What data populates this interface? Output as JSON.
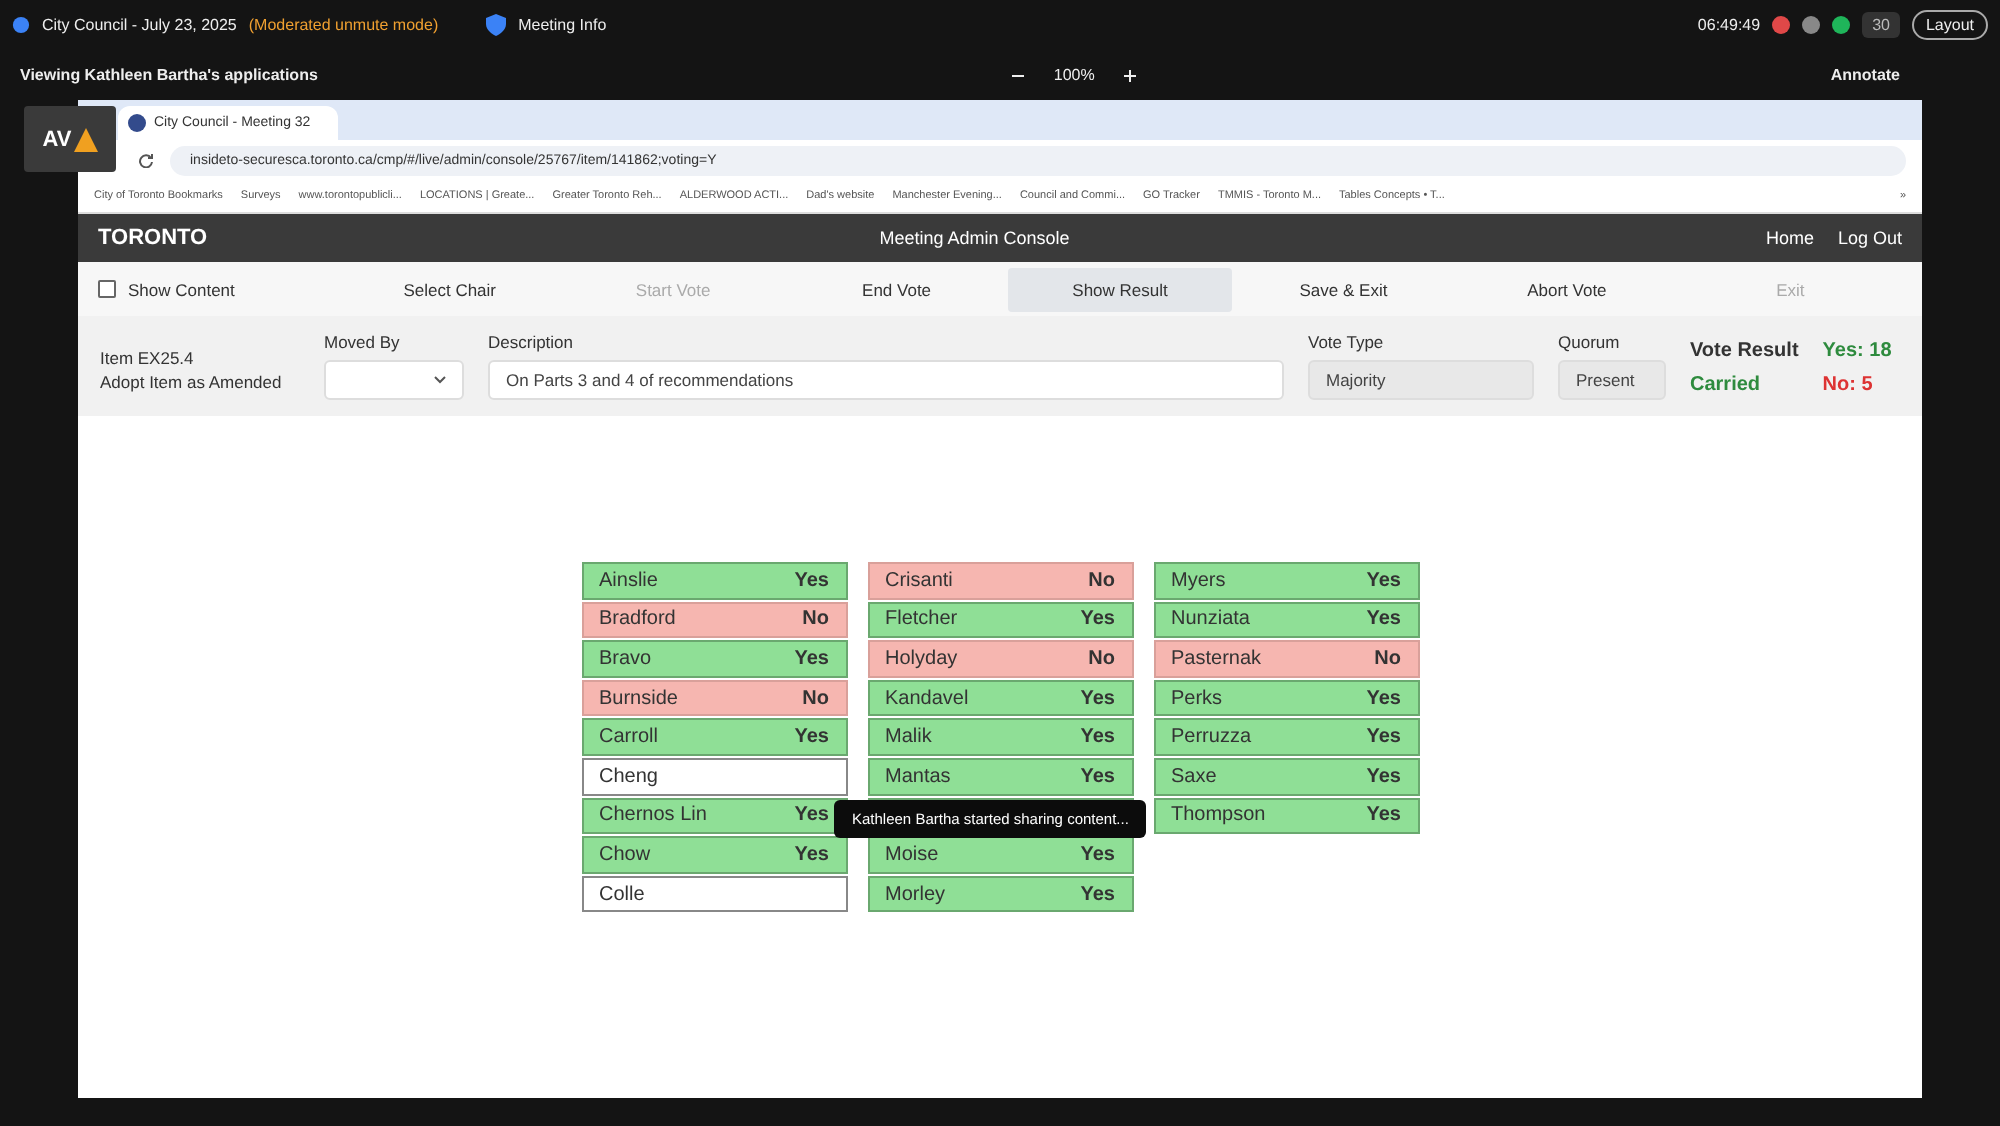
{
  "meeting_bar": {
    "title": "City Council - July 23, 2025",
    "mode": "(Moderated unmute mode)",
    "info": "Meeting Info",
    "time": "06:49:49",
    "participants": "30",
    "layout": "Layout"
  },
  "share_bar": {
    "viewing": "Viewing Kathleen Bartha's applications",
    "zoom": "100%",
    "annotate": "Annotate"
  },
  "badge": {
    "text": "AV"
  },
  "browser": {
    "tab_title": "City Council - Meeting 32",
    "url": "insideto-securesca.toronto.ca/cmp/#/live/admin/console/25767/item/141862;voting=Y",
    "bookmarks": [
      "City of Toronto Bookmarks",
      "Surveys",
      "www.torontopublicli...",
      "LOCATIONS | Greate...",
      "Greater Toronto Reh...",
      "ALDERWOOD ACTI...",
      "Dad's website",
      "Manchester Evening...",
      "Council and Commi...",
      "GO Tracker",
      "TMMIS - Toronto M...",
      "Tables Concepts • T..."
    ],
    "more": "»"
  },
  "app": {
    "logo": "TORONTO",
    "title": "Meeting Admin Console",
    "nav": [
      "Home",
      "Log Out"
    ],
    "toolbar": [
      {
        "kind": "checkbox",
        "label": "Show Content",
        "checked": false
      },
      {
        "kind": "action",
        "label": "Select Chair",
        "disabled": false,
        "selected": false
      },
      {
        "kind": "action",
        "label": "Start Vote",
        "disabled": true,
        "selected": false
      },
      {
        "kind": "action",
        "label": "End Vote",
        "disabled": false,
        "selected": false
      },
      {
        "kind": "action",
        "label": "Show Result",
        "disabled": false,
        "selected": true
      },
      {
        "kind": "action",
        "label": "Save & Exit",
        "disabled": false,
        "selected": false
      },
      {
        "kind": "action",
        "label": "Abort Vote",
        "disabled": false,
        "selected": false
      },
      {
        "kind": "action",
        "label": "Exit",
        "disabled": true,
        "selected": false
      }
    ],
    "item": {
      "number": "Item EX25.4",
      "motion": "Adopt Item as Amended",
      "moved_by_label": "Moved By",
      "description_label": "Description",
      "description": "On Parts 3 and 4 of recommendations",
      "vote_type_label": "Vote Type",
      "vote_type": "Majority",
      "quorum_label": "Quorum",
      "quorum": "Present",
      "result_label": "Vote Result",
      "result": "Carried",
      "yes": "Yes: 18",
      "no": "No: 5"
    },
    "columns": [
      [
        {
          "kind": "yes",
          "name": "Ainslie",
          "vote": "Yes"
        },
        {
          "kind": "no",
          "name": "Bradford",
          "vote": "No"
        },
        {
          "kind": "yes",
          "name": "Bravo",
          "vote": "Yes"
        },
        {
          "kind": "no",
          "name": "Burnside",
          "vote": "No"
        },
        {
          "kind": "yes",
          "name": "Carroll",
          "vote": "Yes"
        },
        {
          "kind": "absent",
          "name": "Cheng"
        },
        {
          "kind": "yes",
          "name": "Chernos Lin",
          "vote": "Yes"
        },
        {
          "kind": "yes",
          "name": "Chow",
          "vote": "Yes"
        },
        {
          "kind": "absent",
          "name": "Colle"
        }
      ],
      [
        {
          "kind": "no",
          "name": "Crisanti",
          "vote": "No"
        },
        {
          "kind": "yes",
          "name": "Fletcher",
          "vote": "Yes"
        },
        {
          "kind": "no",
          "name": "Holyday",
          "vote": "No"
        },
        {
          "kind": "yes",
          "name": "Kandavel",
          "vote": "Yes"
        },
        {
          "kind": "yes",
          "name": "Malik",
          "vote": "Yes"
        },
        {
          "kind": "yes",
          "name": "Mantas",
          "vote": "Yes"
        },
        {
          "kind": "yes"
        },
        {
          "kind": "yes",
          "name": "Moise",
          "vote": "Yes"
        },
        {
          "kind": "yes",
          "name": "Morley",
          "vote": "Yes"
        }
      ],
      [
        {
          "kind": "yes",
          "name": "Myers",
          "vote": "Yes"
        },
        {
          "kind": "yes",
          "name": "Nunziata",
          "vote": "Yes"
        },
        {
          "kind": "no",
          "name": "Pasternak",
          "vote": "No"
        },
        {
          "kind": "yes",
          "name": "Perks",
          "vote": "Yes"
        },
        {
          "kind": "yes",
          "name": "Perruzza",
          "vote": "Yes"
        },
        {
          "kind": "yes",
          "name": "Saxe",
          "vote": "Yes"
        },
        {
          "kind": "yes",
          "name": "Thompson",
          "vote": "Yes"
        }
      ]
    ]
  },
  "toast": "Kathleen Bartha started sharing content..."
}
